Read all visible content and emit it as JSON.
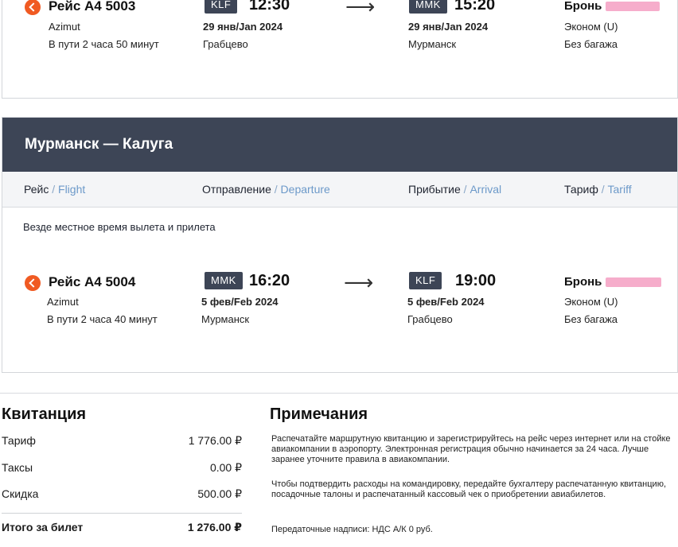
{
  "flight1": {
    "flight_no": "Рейс A4 5003",
    "airline": "Azimut",
    "duration": "В пути 2 часа 50 минут",
    "dep_code": "KLF",
    "dep_time": "12:30",
    "dep_date": "29 янв/Jan 2024",
    "dep_city": "Грабцево",
    "arrow": "⟶",
    "arr_code": "MMK",
    "arr_time": "15:20",
    "arr_date": "29 янв/Jan 2024",
    "arr_city": "Мурманск",
    "booking_label": "Бронь",
    "fare_class": "Эконом (U)",
    "baggage": "Без багажа"
  },
  "route2": {
    "title": "Мурманск — Калуга",
    "cols": [
      {
        "main": "Рейс",
        "en": "Flight"
      },
      {
        "main": "Отправление",
        "en": "Departure"
      },
      {
        "main": "Прибытие",
        "en": "Arrival"
      },
      {
        "main": "Тариф",
        "en": "Tariff"
      }
    ],
    "col_separator": " / ",
    "note": "Везде местное время вылета и прилета"
  },
  "flight2": {
    "flight_no": "Рейс A4 5004",
    "airline": "Azimut",
    "duration": "В пути 2 часа 40 минут",
    "dep_code": "MMK",
    "dep_time": "16:20",
    "dep_date": "5 фев/Feb 2024",
    "dep_city": "Мурманск",
    "arrow": "⟶",
    "arr_code": "KLF",
    "arr_time": "19:00",
    "arr_date": "5 фев/Feb 2024",
    "arr_city": "Грабцево",
    "booking_label": "Бронь",
    "fare_class": "Эконом (U)",
    "baggage": "Без багажа"
  },
  "receipt": {
    "title": "Квитанция",
    "rows": [
      {
        "label": "Тариф",
        "amount": "1 776.00 ₽"
      },
      {
        "label": "Таксы",
        "amount": "0.00 ₽"
      },
      {
        "label": "Скидка",
        "amount": "500.00 ₽"
      }
    ],
    "total": {
      "label": "Итого за билет",
      "amount": "1 276.00 ₽"
    }
  },
  "notes": {
    "title": "Примечания",
    "paragraphs": [
      "Распечатайте маршрутную квитанцию и зарегистрируйтесь на рейс через интернет или на стойке авиакомпании в аэропорту. Электронная регистрация обычно начинается за 24 часа. Лучше заранее уточните правила в авиакомпании.",
      "Чтобы подтвердить расходы на командировку, передайте бухгалтеру распечатанную квитанцию, посадочные талоны и распечатанный кассовый чек о приобретении авиабилетов.",
      "Передаточные надписи: НДС А/К 0 руб."
    ]
  },
  "colors": {
    "header_bg": "#3d4556",
    "accent_orange": "#f05a22",
    "link_blue": "#6c99c9",
    "redaction_pink": "#f6a9c8"
  }
}
